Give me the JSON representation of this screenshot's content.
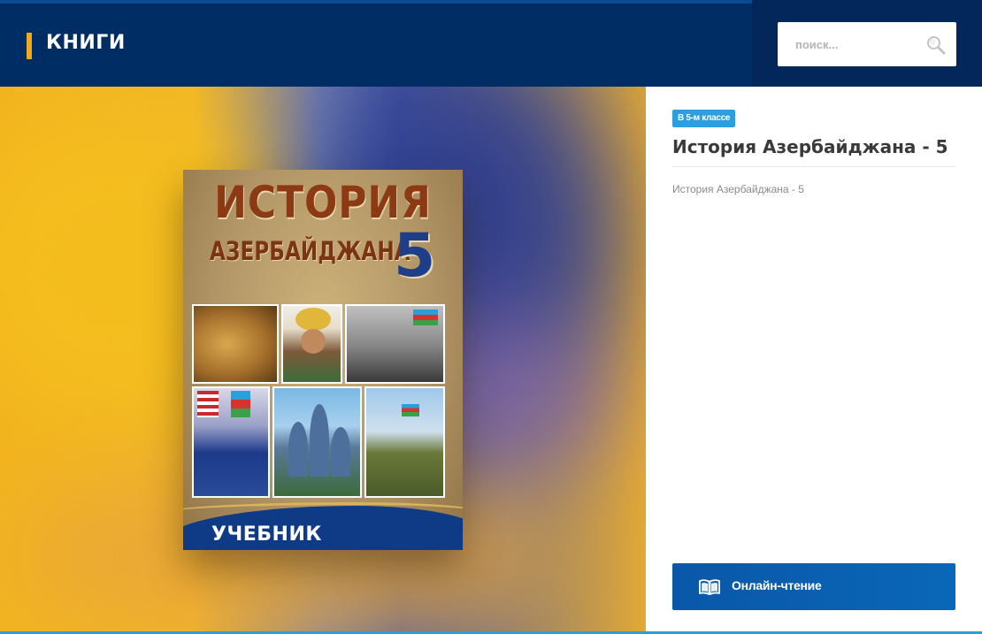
{
  "header": {
    "title": "КНИГИ",
    "search_placeholder": "поиск...",
    "search_icon": "search-icon"
  },
  "cover": {
    "title_line1": "ИСТОРИЯ",
    "title_line2": "АЗЕРБАЙДЖАНА",
    "grade": "5",
    "subtitle": "УЧЕБНИК"
  },
  "info": {
    "badge": "В 5-м классе",
    "title": "История Азербайджана - 5",
    "description": "История Азербайджана - 5",
    "read_button_label": "Онлайн-чтение",
    "read_button_icon": "open-book-icon"
  },
  "colors": {
    "header_bg": "#002d64",
    "brand_accent": "#f0a81c",
    "badge_bg": "#2d9ee0",
    "button_bg": "#0a5fb0"
  }
}
